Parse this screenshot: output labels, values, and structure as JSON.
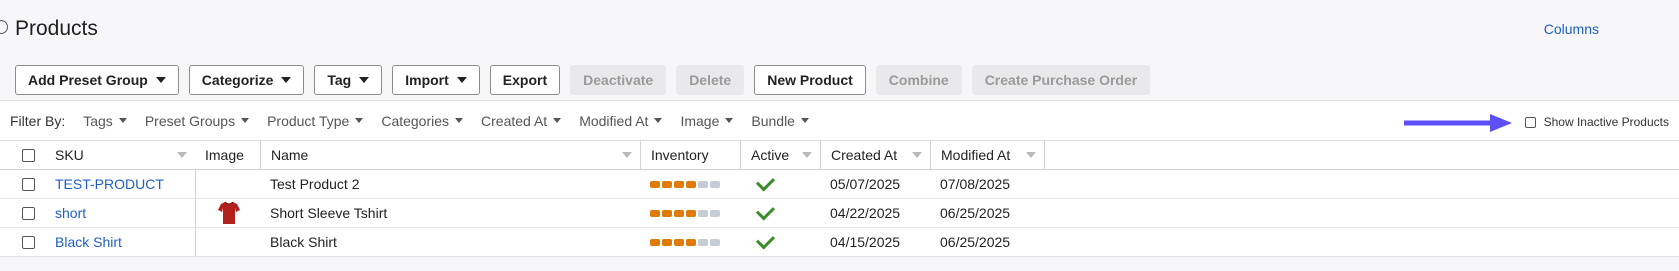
{
  "page": {
    "title": "Products",
    "columns_link": "Columns"
  },
  "toolbar": {
    "add_preset_group": "Add Preset Group",
    "categorize": "Categorize",
    "tag": "Tag",
    "import": "Import",
    "export": "Export",
    "deactivate": "Deactivate",
    "delete": "Delete",
    "new_product": "New Product",
    "combine": "Combine",
    "create_purchase_order": "Create Purchase Order"
  },
  "filters": {
    "label": "Filter By:",
    "items": [
      "Tags",
      "Preset Groups",
      "Product Type",
      "Categories",
      "Created At",
      "Modified At",
      "Image",
      "Bundle"
    ],
    "show_inactive_label": "Show Inactive Products",
    "show_inactive_checked": false
  },
  "grid": {
    "columns": [
      "SKU",
      "Image",
      "Name",
      "Inventory",
      "Active",
      "Created At",
      "Modified At"
    ],
    "rows": [
      {
        "sku": "TEST-PRODUCT",
        "image": "",
        "name": "Test Product 2",
        "inventory_level": 0.7,
        "active": true,
        "created_at": "05/07/2025",
        "modified_at": "07/08/2025"
      },
      {
        "sku": "short",
        "image": "red-tshirt",
        "name": "Short Sleeve Tshirt",
        "inventory_level": 0.7,
        "active": true,
        "created_at": "04/22/2025",
        "modified_at": "06/25/2025"
      },
      {
        "sku": "Black Shirt",
        "image": "",
        "name": "Black Shirt",
        "inventory_level": 0.7,
        "active": true,
        "created_at": "04/15/2025",
        "modified_at": "06/25/2025"
      }
    ]
  },
  "colors": {
    "link": "#1f5fc4",
    "inventory_fill": "#e07b0a",
    "inventory_empty": "#c6ccd6",
    "active_check": "#3a8c2a",
    "annotation_arrow": "#5b4ff5"
  }
}
